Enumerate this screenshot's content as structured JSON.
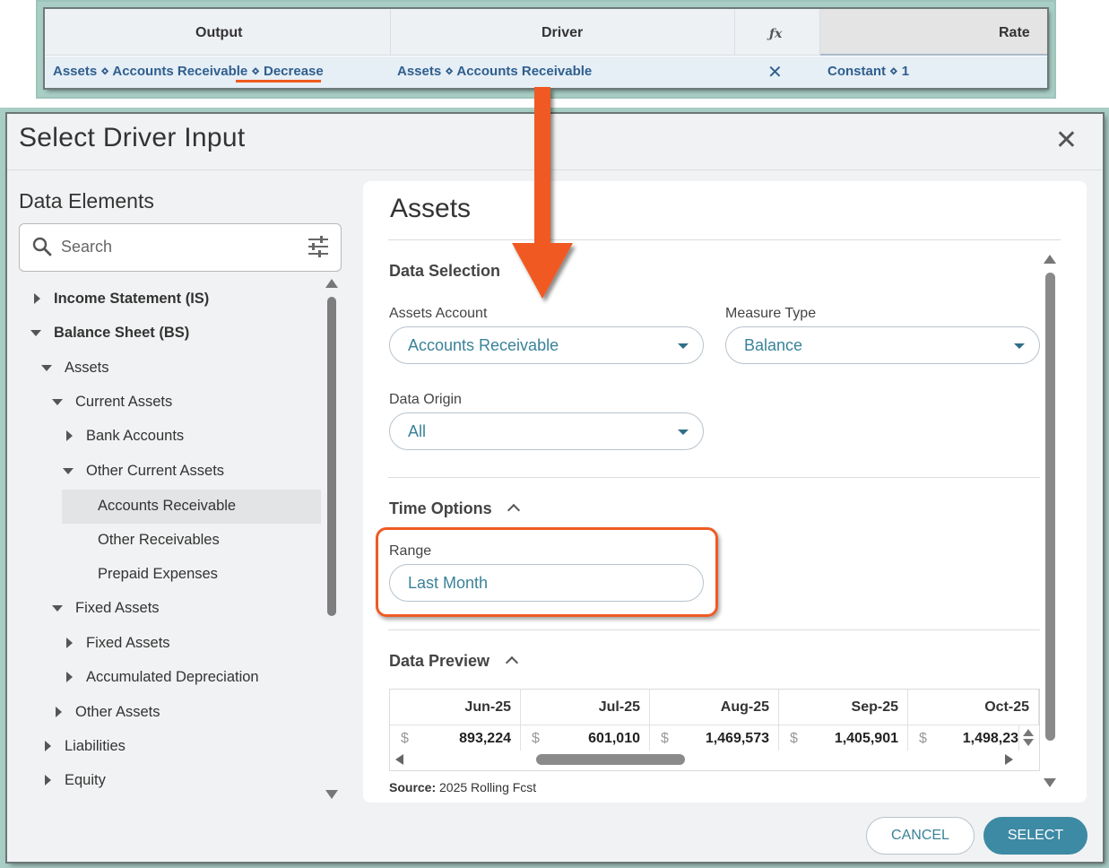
{
  "mapping_table": {
    "headers": {
      "output": "Output",
      "driver": "Driver",
      "fx": "ƒx",
      "rate": "Rate"
    },
    "row": {
      "output_prefix": "Assets ⋄ Accounts Receivable ⋄",
      "output_suffix": "Decrease",
      "driver": "Assets ⋄ Accounts Receivable",
      "fx_symbol": "✕",
      "rate": "Constant ⋄ 1"
    }
  },
  "dialog": {
    "title": "Select Driver Input",
    "close_symbol": "✕",
    "left": {
      "title": "Data Elements",
      "search_placeholder": "Search",
      "tree": [
        {
          "label": "Income Statement (IS)",
          "state": "collapsed"
        },
        {
          "label": "Balance Sheet (BS)",
          "state": "expanded"
        },
        {
          "label": "Assets",
          "state": "expanded"
        },
        {
          "label": "Current Assets",
          "state": "expanded"
        },
        {
          "label": "Bank Accounts",
          "state": "collapsed"
        },
        {
          "label": "Other Current Assets",
          "state": "expanded"
        },
        {
          "label": "Accounts Receivable",
          "state": "selected"
        },
        {
          "label": "Other Receivables",
          "state": "leaf"
        },
        {
          "label": "Prepaid Expenses",
          "state": "leaf"
        },
        {
          "label": "Fixed Assets",
          "state": "expanded"
        },
        {
          "label": "Fixed Assets",
          "state": "collapsed"
        },
        {
          "label": "Accumulated Depreciation",
          "state": "collapsed"
        },
        {
          "label": "Other Assets",
          "state": "collapsed"
        },
        {
          "label": "Liabilities",
          "state": "collapsed"
        },
        {
          "label": "Equity",
          "state": "collapsed"
        }
      ]
    },
    "right": {
      "title": "Assets",
      "data_selection": {
        "heading": "Data Selection",
        "assets_account_label": "Assets Account",
        "assets_account_value": "Accounts Receivable",
        "measure_type_label": "Measure Type",
        "measure_type_value": "Balance",
        "data_origin_label": "Data Origin",
        "data_origin_value": "All"
      },
      "time_options": {
        "heading": "Time Options",
        "range_label": "Range",
        "range_value": "Last Month"
      },
      "data_preview": {
        "heading": "Data Preview",
        "currency": "$",
        "columns": [
          "Jun-25",
          "Jul-25",
          "Aug-25",
          "Sep-25",
          "Oct-25"
        ],
        "values": [
          "893,224",
          "601,010",
          "1,469,573",
          "1,405,901",
          "1,498,23"
        ],
        "source_label": "Source:",
        "source_value": "2025 Rolling Fcst"
      }
    },
    "buttons": {
      "cancel": "CANCEL",
      "select": "SELECT"
    }
  },
  "colors": {
    "accent": "#3d8aa4",
    "link_blue": "#2f5f8d",
    "highlight_orange": "#ee5b24",
    "frame_teal": "#a9cec5"
  }
}
